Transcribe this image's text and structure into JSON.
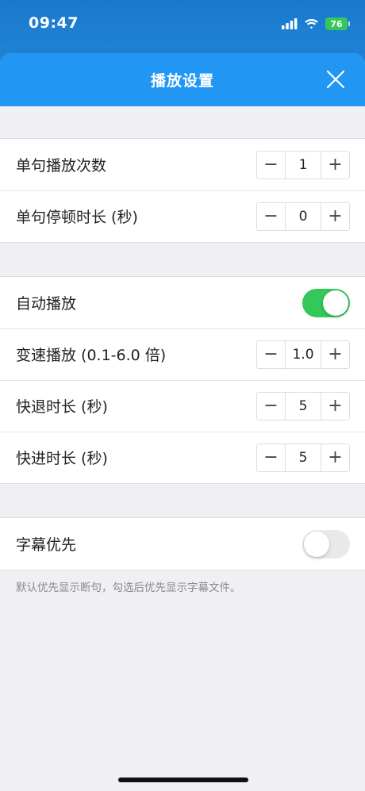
{
  "status_bar": {
    "time": "09:47",
    "battery": "76",
    "icons": [
      "signal-icon",
      "wifi-icon",
      "battery-icon"
    ]
  },
  "header": {
    "title": "播放设置",
    "close_icon": "close-icon"
  },
  "groups": {
    "repeat": {
      "rows": [
        {
          "label": "单句播放次数",
          "value": "1"
        },
        {
          "label": "单句停顿时长 (秒)",
          "value": "0"
        }
      ]
    },
    "playback": {
      "auto_play": {
        "label": "自动播放",
        "enabled": true
      },
      "rows": [
        {
          "label": "变速播放 (0.1-6.0 倍)",
          "value": "1.0"
        },
        {
          "label": "快退时长 (秒)",
          "value": "5"
        },
        {
          "label": "快进时长 (秒)",
          "value": "5"
        }
      ]
    },
    "subtitle": {
      "label": "字幕优先",
      "enabled": false,
      "footnote": "默认优先显示断句，勾选后优先显示字幕文件。"
    }
  },
  "stepper": {
    "minus": "−",
    "plus": "+"
  },
  "colors": {
    "header": "#2196f3",
    "toggle_on": "#34c759",
    "toggle_off": "#e9e9ea",
    "background": "#efeff4"
  }
}
